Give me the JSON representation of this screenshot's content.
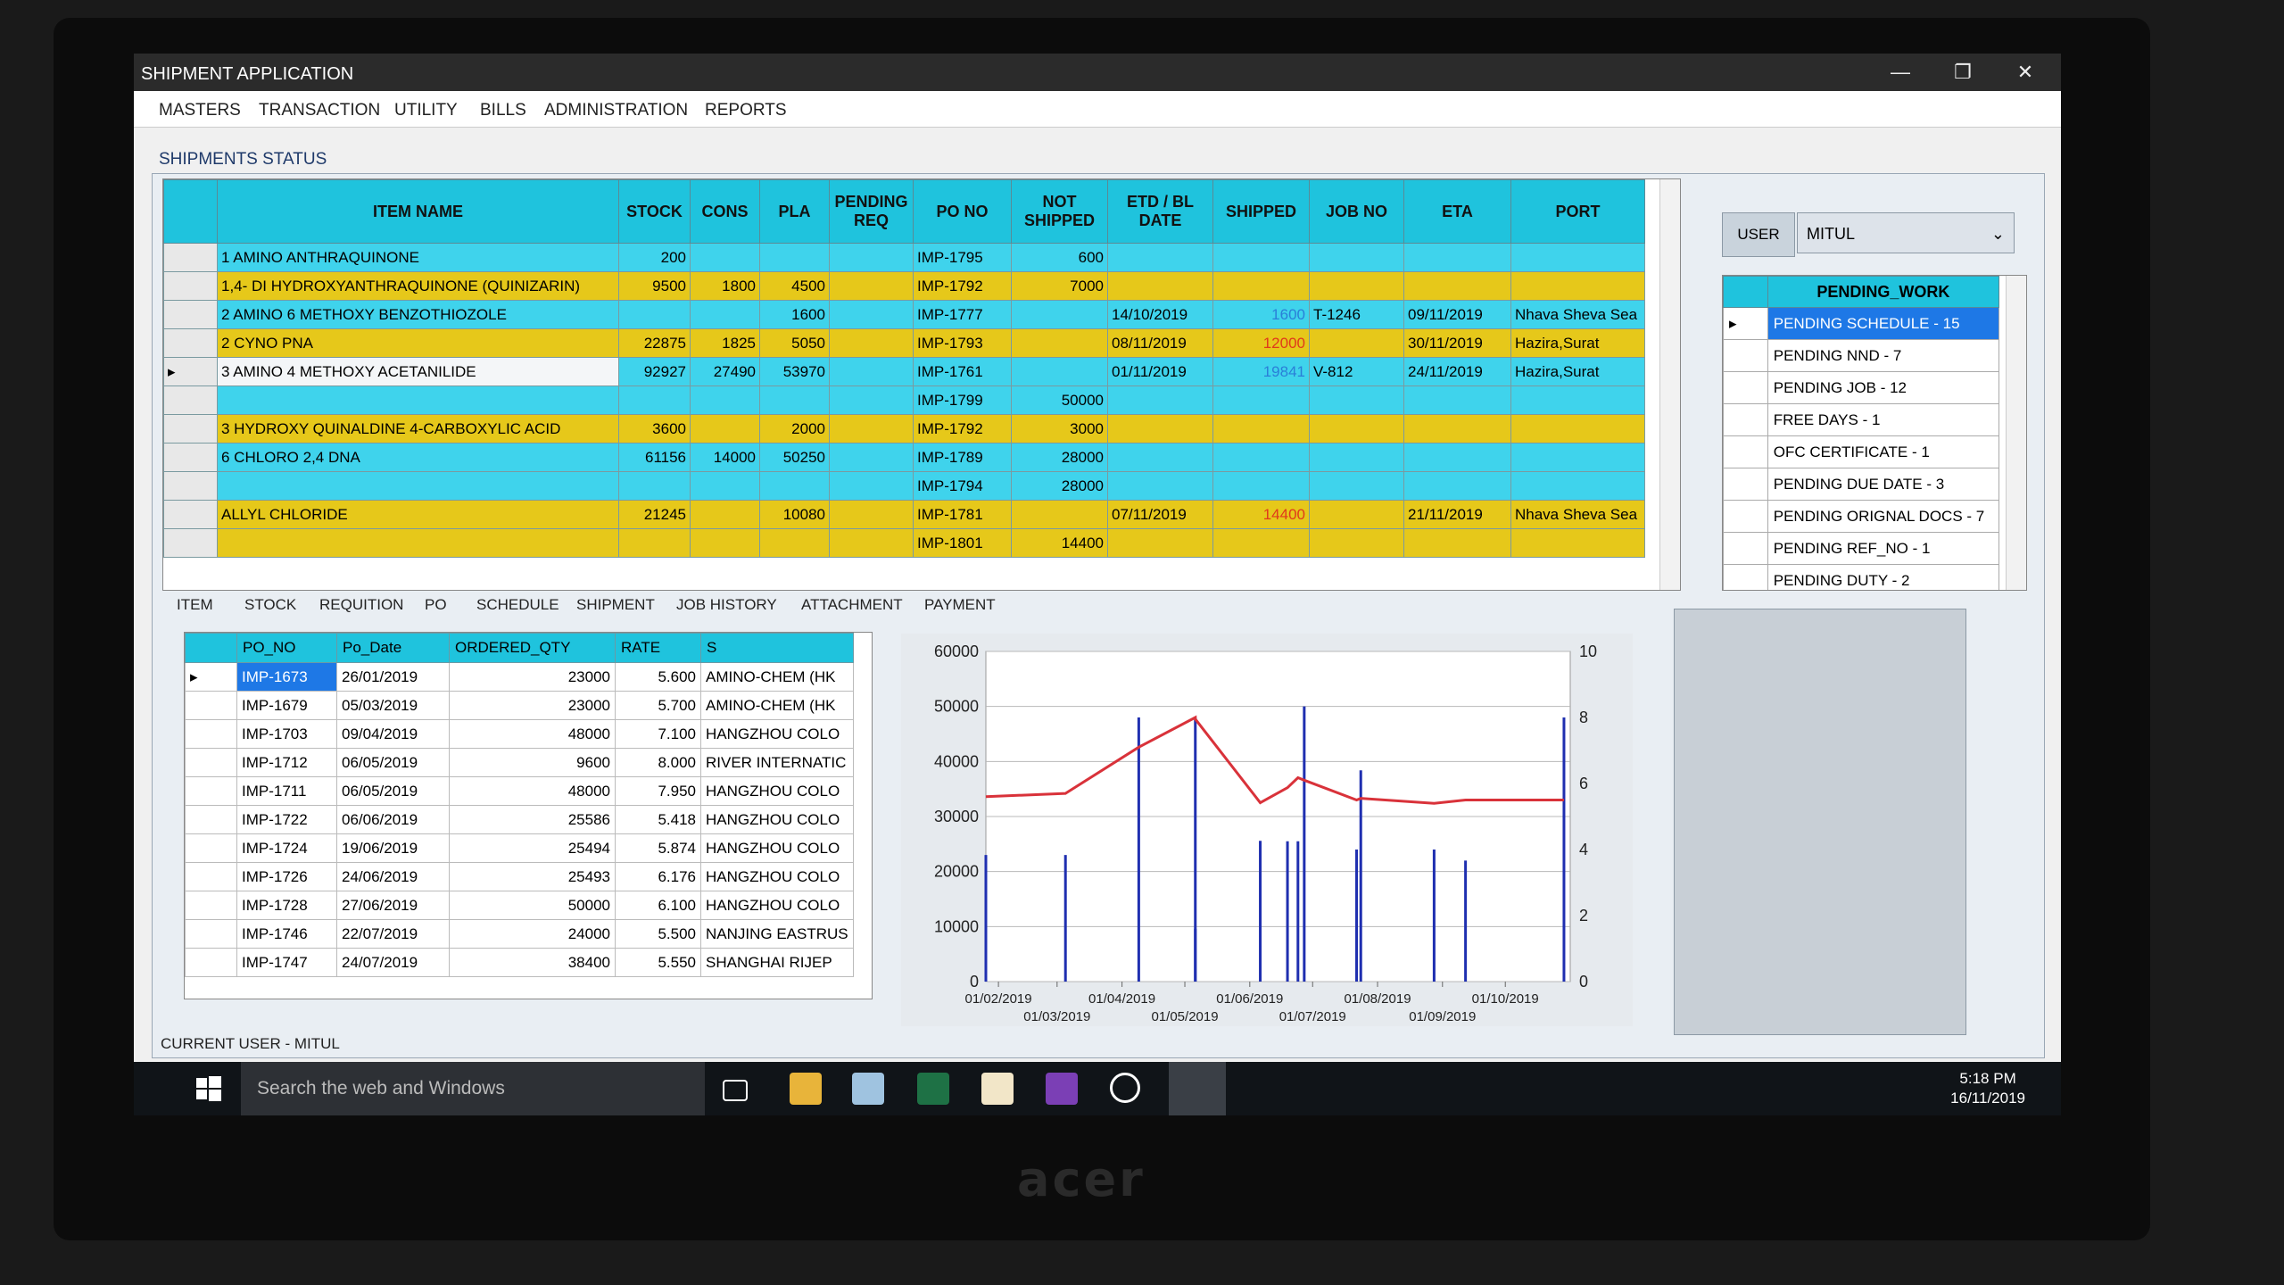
{
  "app_title": "SHIPMENT APPLICATION",
  "menu": [
    "MASTERS",
    "TRANSACTION",
    "UTILITY",
    "BILLS",
    "ADMINISTRATION",
    "REPORTS"
  ],
  "panel_title": "SHIPMENTS STATUS",
  "grid": {
    "headers": [
      "ITEM NAME",
      "STOCK",
      "CONS",
      "PLA",
      "PENDING REQ",
      "PO NO",
      "NOT SHIPPED",
      "ETD / BL DATE",
      "SHIPPED",
      "JOB NO",
      "ETA",
      "PORT"
    ],
    "rows": [
      {
        "color": "cyan",
        "item": "1 AMINO ANTHRAQUINONE",
        "stock": "200",
        "cons": "",
        "pla": "",
        "req": "",
        "po": "IMP-1795",
        "not_shipped": "600",
        "etd": "",
        "shipped": "",
        "job": "",
        "eta": "",
        "port": ""
      },
      {
        "color": "yellow",
        "item": "1,4- DI HYDROXYANTHRAQUINONE (QUINIZARIN)",
        "stock": "9500",
        "cons": "1800",
        "pla": "4500",
        "req": "",
        "po": "IMP-1792",
        "not_shipped": "7000",
        "etd": "",
        "shipped": "",
        "job": "",
        "eta": "",
        "port": ""
      },
      {
        "color": "cyan",
        "item": "2 AMINO 6 METHOXY BENZOTHIOZOLE",
        "stock": "",
        "cons": "",
        "pla": "1600",
        "req": "",
        "po": "IMP-1777",
        "not_shipped": "",
        "etd": "14/10/2019",
        "shipped": "1600",
        "job": "T-1246",
        "eta": "09/11/2019",
        "port": "Nhava Sheva Sea"
      },
      {
        "color": "yellow",
        "item": "2 CYNO PNA",
        "stock": "22875",
        "cons": "1825",
        "pla": "5050",
        "req": "",
        "po": "IMP-1793",
        "not_shipped": "",
        "etd": "08/11/2019",
        "shipped": "12000",
        "job": "",
        "eta": "30/11/2019",
        "port": "Hazira,Surat"
      },
      {
        "color": "cyan",
        "item": "3 AMINO 4 METHOXY ACETANILIDE",
        "stock": "92927",
        "cons": "27490",
        "pla": "53970",
        "req": "",
        "po": "IMP-1761",
        "not_shipped": "",
        "etd": "01/11/2019",
        "shipped": "19841",
        "job": "V-812",
        "eta": "24/11/2019",
        "port": "Hazira,Surat",
        "current": true
      },
      {
        "color": "cyan",
        "item": "",
        "stock": "",
        "cons": "",
        "pla": "",
        "req": "",
        "po": "IMP-1799",
        "not_shipped": "50000",
        "etd": "",
        "shipped": "",
        "job": "",
        "eta": "",
        "port": ""
      },
      {
        "color": "yellow",
        "item": "3 HYDROXY QUINALDINE 4-CARBOXYLIC ACID",
        "stock": "3600",
        "cons": "",
        "pla": "2000",
        "req": "",
        "po": "IMP-1792",
        "not_shipped": "3000",
        "etd": "",
        "shipped": "",
        "job": "",
        "eta": "",
        "port": ""
      },
      {
        "color": "cyan",
        "item": "6 CHLORO 2,4 DNA",
        "stock": "61156",
        "cons": "14000",
        "pla": "50250",
        "req": "",
        "po": "IMP-1789",
        "not_shipped": "28000",
        "etd": "",
        "shipped": "",
        "job": "",
        "eta": "",
        "port": ""
      },
      {
        "color": "cyan",
        "item": "",
        "stock": "",
        "cons": "",
        "pla": "",
        "req": "",
        "po": "IMP-1794",
        "not_shipped": "28000",
        "etd": "",
        "shipped": "",
        "job": "",
        "eta": "",
        "port": ""
      },
      {
        "color": "yellow",
        "item": "ALLYL CHLORIDE",
        "stock": "21245",
        "cons": "",
        "pla": "10080",
        "req": "",
        "po": "IMP-1781",
        "not_shipped": "",
        "etd": "07/11/2019",
        "shipped": "14400",
        "job": "",
        "eta": "21/11/2019",
        "port": "Nhava Sheva Sea"
      },
      {
        "color": "yellow",
        "item": "",
        "stock": "",
        "cons": "",
        "pla": "",
        "req": "",
        "po": "IMP-1801",
        "not_shipped": "14400",
        "etd": "",
        "shipped": "",
        "job": "",
        "eta": "",
        "port": ""
      }
    ]
  },
  "user": {
    "label": "USER",
    "value": "MITUL"
  },
  "pending_work": {
    "header": "PENDING_WORK",
    "items": [
      "PENDING SCHEDULE - 15",
      "PENDING NND - 7",
      "PENDING JOB - 12",
      "FREE DAYS - 1",
      "OFC CERTIFICATE - 1",
      "PENDING DUE DATE - 3",
      "PENDING ORIGNAL DOCS - 7",
      "PENDING REF_NO - 1",
      "PENDING DUTY - 2"
    ]
  },
  "tabs": [
    "ITEM",
    "STOCK",
    "REQUITION",
    "PO",
    "SCHEDULE",
    "SHIPMENT",
    "JOB HISTORY",
    "ATTACHMENT",
    "PAYMENT"
  ],
  "po_grid": {
    "headers": [
      "PO_NO",
      "Po_Date",
      "ORDERED_QTY",
      "RATE",
      "S"
    ],
    "rows": [
      [
        "IMP-1673",
        "26/01/2019",
        "23000",
        "5.600",
        "AMINO-CHEM (HK"
      ],
      [
        "IMP-1679",
        "05/03/2019",
        "23000",
        "5.700",
        "AMINO-CHEM (HK"
      ],
      [
        "IMP-1703",
        "09/04/2019",
        "48000",
        "7.100",
        "HANGZHOU COLO"
      ],
      [
        "IMP-1712",
        "06/05/2019",
        "9600",
        "8.000",
        "RIVER INTERNATIC"
      ],
      [
        "IMP-1711",
        "06/05/2019",
        "48000",
        "7.950",
        "HANGZHOU COLO"
      ],
      [
        "IMP-1722",
        "06/06/2019",
        "25586",
        "5.418",
        "HANGZHOU COLO"
      ],
      [
        "IMP-1724",
        "19/06/2019",
        "25494",
        "5.874",
        "HANGZHOU COLO"
      ],
      [
        "IMP-1726",
        "24/06/2019",
        "25493",
        "6.176",
        "HANGZHOU COLO"
      ],
      [
        "IMP-1728",
        "27/06/2019",
        "50000",
        "6.100",
        "HANGZHOU COLO"
      ],
      [
        "IMP-1746",
        "22/07/2019",
        "24000",
        "5.500",
        "NANJING EASTRUS"
      ],
      [
        "IMP-1747",
        "24/07/2019",
        "38400",
        "5.550",
        "SHANGHAI RIJEP"
      ]
    ]
  },
  "chart_data": {
    "type": "line",
    "x_ticks": [
      "01/02/2019",
      "01/03/2019",
      "01/04/2019",
      "01/05/2019",
      "01/06/2019",
      "01/07/2019",
      "01/08/2019",
      "01/09/2019",
      "01/10/2019"
    ],
    "y_left_ticks": [
      "0",
      "10000",
      "20000",
      "30000",
      "40000",
      "50000",
      "60000"
    ],
    "y_right_ticks": [
      "0",
      "2",
      "4",
      "6",
      "8",
      "10"
    ],
    "ylim_left": [
      0,
      60000
    ],
    "ylim_right": [
      0,
      10
    ],
    "xlim": [
      "2019-01-26",
      "2019-11-01"
    ],
    "series": [
      {
        "type": "bar",
        "color": "#1f2fb0",
        "points": [
          [
            "2019-01-26",
            23000
          ],
          [
            "2019-03-05",
            23000
          ],
          [
            "2019-04-09",
            48000
          ],
          [
            "2019-05-06",
            9600
          ],
          [
            "2019-05-06",
            48000
          ],
          [
            "2019-06-06",
            25586
          ],
          [
            "2019-06-19",
            25494
          ],
          [
            "2019-06-24",
            25493
          ],
          [
            "2019-06-27",
            50000
          ],
          [
            "2019-07-22",
            24000
          ],
          [
            "2019-07-24",
            38400
          ],
          [
            "2019-08-28",
            24000
          ],
          [
            "2019-09-12",
            22000
          ],
          [
            "2019-10-29",
            48000
          ]
        ]
      },
      {
        "type": "line",
        "color": "#d9323a",
        "points": [
          [
            "2019-01-26",
            5.6
          ],
          [
            "2019-03-05",
            5.7
          ],
          [
            "2019-04-09",
            7.1
          ],
          [
            "2019-05-06",
            8.0
          ],
          [
            "2019-05-06",
            7.95
          ],
          [
            "2019-06-06",
            5.418
          ],
          [
            "2019-06-19",
            5.874
          ],
          [
            "2019-06-24",
            6.176
          ],
          [
            "2019-06-27",
            6.1
          ],
          [
            "2019-07-22",
            5.5
          ],
          [
            "2019-07-24",
            5.55
          ],
          [
            "2019-08-28",
            5.4
          ],
          [
            "2019-09-12",
            5.5
          ],
          [
            "2019-10-29",
            5.5
          ]
        ]
      }
    ]
  },
  "status_bar": "CURRENT USER   - MITUL",
  "taskbar": {
    "search": "Search the web and Windows",
    "time": "5:18 PM",
    "date": "16/11/2019"
  },
  "brand": "acer",
  "window_controls": {
    "minimize": "—",
    "restore": "❐",
    "close": "✕"
  }
}
